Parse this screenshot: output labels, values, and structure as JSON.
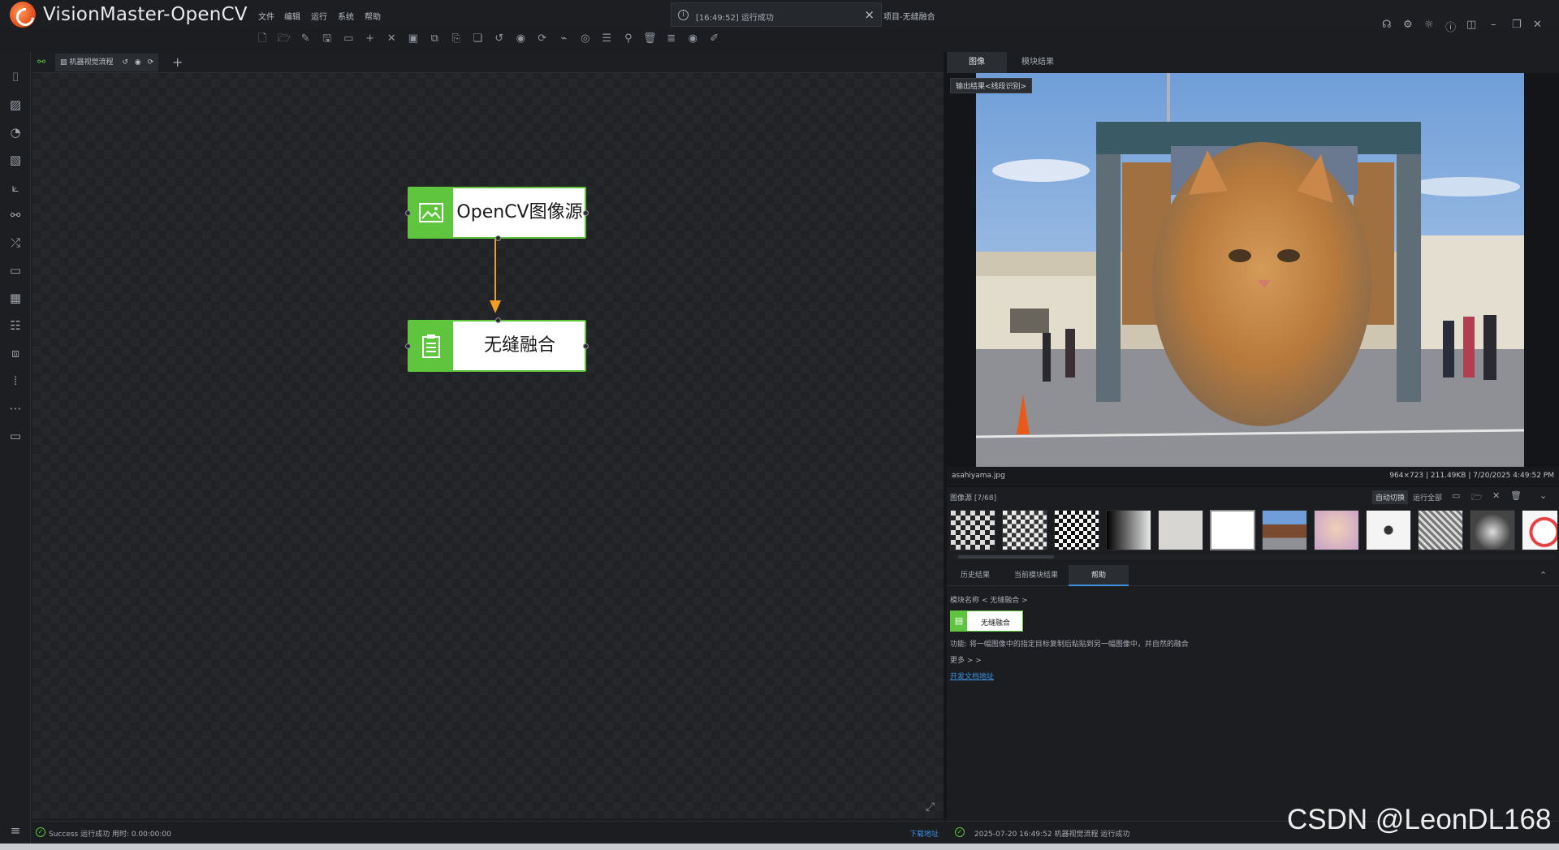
{
  "app": {
    "title": "VisionMaster-OpenCV",
    "project_title": "项目-无缝融合"
  },
  "menu": [
    "文件",
    "编辑",
    "运行",
    "系统",
    "帮助"
  ],
  "toast": {
    "message": "[16:49:52] 运行成功"
  },
  "toolbar_icons": [
    "new-file-icon",
    "open-folder-icon",
    "edit-icon",
    "save-icon",
    "comment-icon",
    "add-icon",
    "delete-icon",
    "copy-icon",
    "paste-icon",
    "export-icon",
    "duplicate-icon",
    "history-icon",
    "record-icon",
    "refresh-icon",
    "brush-icon",
    "view-icon",
    "align-icon",
    "zoom-icon",
    "trash-icon",
    "list-icon",
    "eye-icon",
    "pen-icon"
  ],
  "canvas": {
    "tab_label": "机器视觉流程",
    "nodes": [
      {
        "label": "OpenCV图像源",
        "icon": "image-icon"
      },
      {
        "label": "无缝融合",
        "icon": "clipboard-icon"
      }
    ]
  },
  "right_panel": {
    "tabs": [
      "图像",
      "模块结果"
    ],
    "overlay_label": "输出结果<线段识别>",
    "image": {
      "filename": "asahiyama.jpg",
      "meta": "964×723 | 211.49KB | 7/20/2025 4:49:52 PM"
    },
    "thumbs_title": "图像源 [7/68]",
    "thumbs_actions": {
      "auto_switch": "自动切换",
      "run_all": "运行全部"
    },
    "thumbnails": 12,
    "bottom_tabs": [
      "历史结果",
      "当前模块结果",
      "帮助"
    ],
    "help": {
      "module_name": "模块名称 < 无缝融合 >",
      "module_badge": "无缝融合",
      "description": "功能: 将一幅图像中的指定目标复制后粘贴到另一幅图像中，并自然的融合",
      "more": "更多 > >",
      "doc_link": "开发文档地址"
    }
  },
  "status": {
    "left": "Success 运行成功 用时: 0.00:00:00",
    "left_link": "下载地址",
    "right": "2025-07-20 16:49:52  机器视觉流程 运行成功"
  },
  "watermark": "CSDN @LeonDL168",
  "colors": {
    "accent_green": "#5fc43e",
    "arrow": "#f0a020",
    "link": "#3d8fe0"
  }
}
